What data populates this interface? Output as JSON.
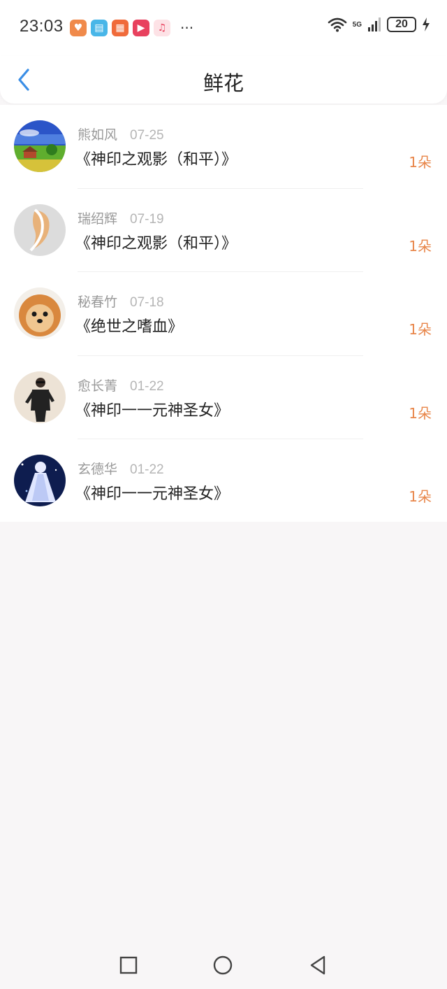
{
  "status_bar": {
    "time": "23:03",
    "battery": "20",
    "network": "5G"
  },
  "header": {
    "title": "鲜花"
  },
  "items": [
    {
      "name": "熊如风",
      "date": "07-25",
      "work": "《神印之观影（和平）》",
      "count": "1朵"
    },
    {
      "name": "瑞绍辉",
      "date": "07-19",
      "work": "《神印之观影（和平）》",
      "count": "1朵"
    },
    {
      "name": "秘春竹",
      "date": "07-18",
      "work": "《绝世之嗜血》",
      "count": "1朵"
    },
    {
      "name": "愈长菁",
      "date": "01-22",
      "work": "《神印一一元神圣女》",
      "count": "1朵"
    },
    {
      "name": "玄德华",
      "date": "01-22",
      "work": "《神印一一元神圣女》",
      "count": "1朵"
    }
  ],
  "icons": {
    "back": "chevron-left-icon",
    "nav_recent": "square-icon",
    "nav_home": "circle-icon",
    "nav_back": "triangle-back-icon"
  },
  "colors": {
    "accent": "#3a8ee6",
    "count": "#e8864a"
  }
}
